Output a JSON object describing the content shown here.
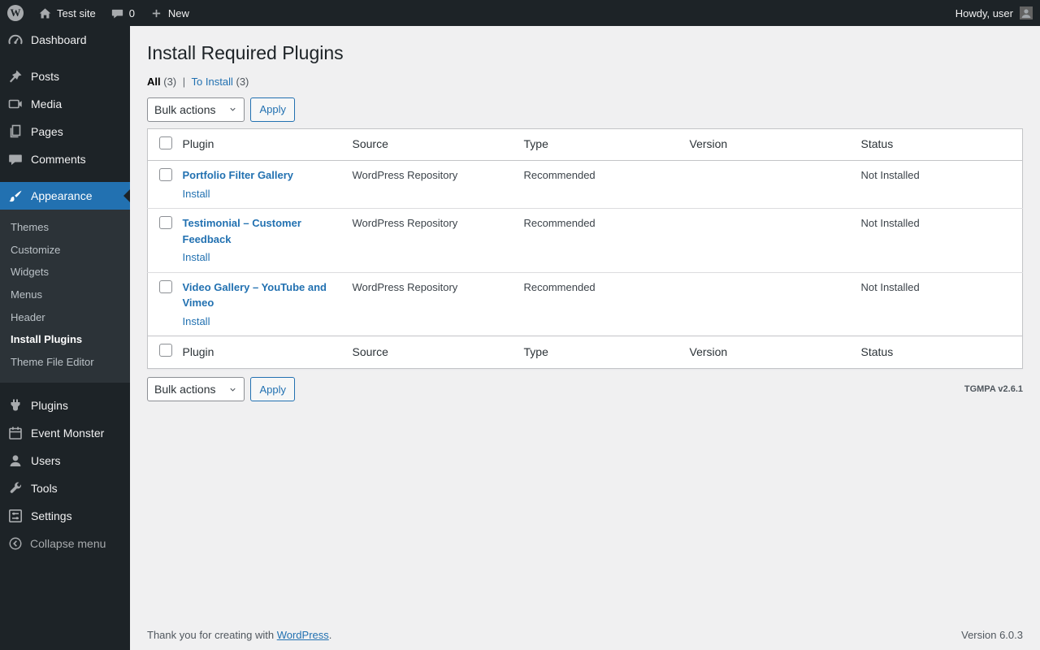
{
  "admin_bar": {
    "site_name": "Test site",
    "comments_count": "0",
    "new_label": "New",
    "howdy": "Howdy, user"
  },
  "sidebar": {
    "items": [
      {
        "label": "Dashboard"
      },
      {
        "label": "Posts"
      },
      {
        "label": "Media"
      },
      {
        "label": "Pages"
      },
      {
        "label": "Comments"
      },
      {
        "label": "Appearance"
      },
      {
        "label": "Plugins"
      },
      {
        "label": "Event Monster"
      },
      {
        "label": "Users"
      },
      {
        "label": "Tools"
      },
      {
        "label": "Settings"
      },
      {
        "label": "Collapse menu"
      }
    ],
    "appearance_submenu": [
      {
        "label": "Themes"
      },
      {
        "label": "Customize"
      },
      {
        "label": "Widgets"
      },
      {
        "label": "Menus"
      },
      {
        "label": "Header"
      },
      {
        "label": "Install Plugins"
      },
      {
        "label": "Theme File Editor"
      }
    ]
  },
  "page": {
    "title": "Install Required Plugins",
    "filters": {
      "all": "All",
      "all_count": "(3)",
      "separator": "|",
      "to_install": "To Install",
      "to_install_count": "(3)"
    },
    "bulk_actions_label": "Bulk actions",
    "apply_label": "Apply",
    "table": {
      "headers": {
        "plugin": "Plugin",
        "source": "Source",
        "type": "Type",
        "version": "Version",
        "status": "Status"
      },
      "rows": [
        {
          "plugin": "Portfolio Filter Gallery",
          "action": "Install",
          "source": "WordPress Repository",
          "type": "Recommended",
          "version": "",
          "status": "Not Installed"
        },
        {
          "plugin": "Testimonial – Customer Feedback",
          "action": "Install",
          "source": "WordPress Repository",
          "type": "Recommended",
          "version": "",
          "status": "Not Installed"
        },
        {
          "plugin": "Video Gallery – YouTube and Vimeo",
          "action": "Install",
          "source": "WordPress Repository",
          "type": "Recommended",
          "version": "",
          "status": "Not Installed"
        }
      ]
    },
    "tgmpa_version": "TGMPA v2.6.1"
  },
  "footer": {
    "thanks": "Thank you for creating with ",
    "wordpress_link": "WordPress",
    "period": ".",
    "version": "Version 6.0.3"
  },
  "colors": {
    "accent": "#2271b1",
    "admin_bar_bg": "#1d2327",
    "menu_bg": "#1d2327",
    "submenu_bg": "#2c3338",
    "content_bg": "#f0f0f1",
    "table_border": "#c3c4c7"
  }
}
